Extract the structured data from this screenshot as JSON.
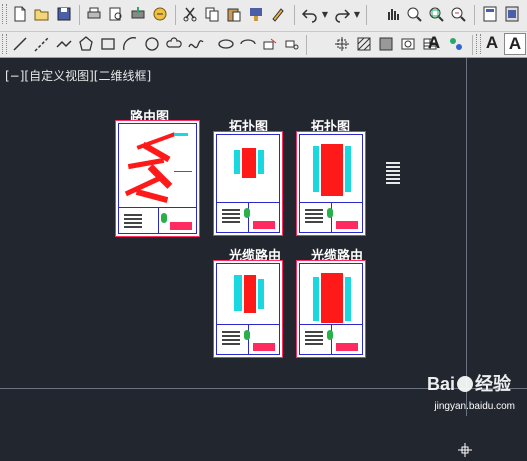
{
  "toolbar_top": {
    "buttons": [
      "new-icon",
      "open-icon",
      "save-icon",
      "print-icon",
      "print-preview-icon",
      "plot-icon",
      "publish-icon",
      "cut-icon",
      "copy-icon",
      "paste-icon",
      "match-properties-icon",
      "brush-icon",
      "undo-icon",
      "redo-icon",
      "pan-icon",
      "zoom-realtime-icon",
      "zoom-window-icon",
      "zoom-previous-icon",
      "properties-icon",
      "design-center-icon"
    ]
  },
  "toolbar_draw": {
    "buttons": [
      "line-icon",
      "construction-line-icon",
      "polyline-icon",
      "polygon-icon",
      "rectangle-icon",
      "arc-icon",
      "circle-icon",
      "revision-cloud-icon",
      "spline-icon",
      "ellipse-icon",
      "ellipse-arc-icon",
      "insert-block-icon",
      "make-block-icon",
      "point-icon",
      "hatch-icon",
      "gradient-icon",
      "region-icon",
      "table-icon",
      "multiline-text-icon",
      "add-selected-icon"
    ],
    "text_a1": "A",
    "text_a2": "A",
    "text_a3": "A"
  },
  "canvas": {
    "viewport_label": "[−][自定义视图][二维线框]"
  },
  "sheets": [
    {
      "title": "路由图"
    },
    {
      "title": "拓扑图"
    },
    {
      "title": "拓扑图"
    },
    {
      "title": "光缆路由"
    },
    {
      "title": "光缆路由"
    }
  ],
  "watermark": {
    "brand_left": "Bai",
    "brand_right": "经验",
    "url": "jingyan.baidu.com"
  },
  "colors": {
    "canvas_bg": "#21262f",
    "toolbar_bg": "#ebebeb",
    "sheet_border": "#ff2a60",
    "frame_blue": "#2a2acc",
    "route_red": "#ff1a1a",
    "cable_cyan": "#1ad8e0"
  }
}
